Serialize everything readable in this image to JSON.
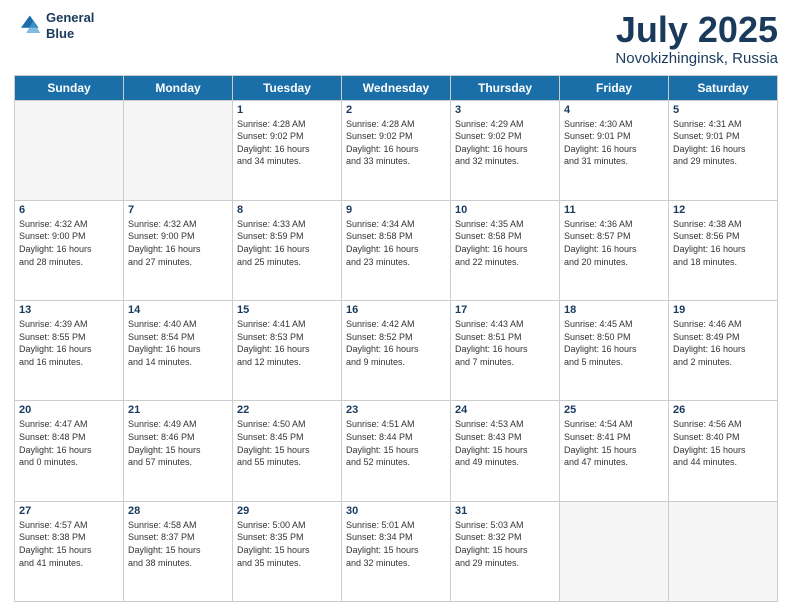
{
  "logo": {
    "line1": "General",
    "line2": "Blue"
  },
  "title": "July 2025",
  "location": "Novokizhinginsk, Russia",
  "header_days": [
    "Sunday",
    "Monday",
    "Tuesday",
    "Wednesday",
    "Thursday",
    "Friday",
    "Saturday"
  ],
  "weeks": [
    [
      {
        "day": "",
        "info": ""
      },
      {
        "day": "",
        "info": ""
      },
      {
        "day": "1",
        "info": "Sunrise: 4:28 AM\nSunset: 9:02 PM\nDaylight: 16 hours\nand 34 minutes."
      },
      {
        "day": "2",
        "info": "Sunrise: 4:28 AM\nSunset: 9:02 PM\nDaylight: 16 hours\nand 33 minutes."
      },
      {
        "day": "3",
        "info": "Sunrise: 4:29 AM\nSunset: 9:02 PM\nDaylight: 16 hours\nand 32 minutes."
      },
      {
        "day": "4",
        "info": "Sunrise: 4:30 AM\nSunset: 9:01 PM\nDaylight: 16 hours\nand 31 minutes."
      },
      {
        "day": "5",
        "info": "Sunrise: 4:31 AM\nSunset: 9:01 PM\nDaylight: 16 hours\nand 29 minutes."
      }
    ],
    [
      {
        "day": "6",
        "info": "Sunrise: 4:32 AM\nSunset: 9:00 PM\nDaylight: 16 hours\nand 28 minutes."
      },
      {
        "day": "7",
        "info": "Sunrise: 4:32 AM\nSunset: 9:00 PM\nDaylight: 16 hours\nand 27 minutes."
      },
      {
        "day": "8",
        "info": "Sunrise: 4:33 AM\nSunset: 8:59 PM\nDaylight: 16 hours\nand 25 minutes."
      },
      {
        "day": "9",
        "info": "Sunrise: 4:34 AM\nSunset: 8:58 PM\nDaylight: 16 hours\nand 23 minutes."
      },
      {
        "day": "10",
        "info": "Sunrise: 4:35 AM\nSunset: 8:58 PM\nDaylight: 16 hours\nand 22 minutes."
      },
      {
        "day": "11",
        "info": "Sunrise: 4:36 AM\nSunset: 8:57 PM\nDaylight: 16 hours\nand 20 minutes."
      },
      {
        "day": "12",
        "info": "Sunrise: 4:38 AM\nSunset: 8:56 PM\nDaylight: 16 hours\nand 18 minutes."
      }
    ],
    [
      {
        "day": "13",
        "info": "Sunrise: 4:39 AM\nSunset: 8:55 PM\nDaylight: 16 hours\nand 16 minutes."
      },
      {
        "day": "14",
        "info": "Sunrise: 4:40 AM\nSunset: 8:54 PM\nDaylight: 16 hours\nand 14 minutes."
      },
      {
        "day": "15",
        "info": "Sunrise: 4:41 AM\nSunset: 8:53 PM\nDaylight: 16 hours\nand 12 minutes."
      },
      {
        "day": "16",
        "info": "Sunrise: 4:42 AM\nSunset: 8:52 PM\nDaylight: 16 hours\nand 9 minutes."
      },
      {
        "day": "17",
        "info": "Sunrise: 4:43 AM\nSunset: 8:51 PM\nDaylight: 16 hours\nand 7 minutes."
      },
      {
        "day": "18",
        "info": "Sunrise: 4:45 AM\nSunset: 8:50 PM\nDaylight: 16 hours\nand 5 minutes."
      },
      {
        "day": "19",
        "info": "Sunrise: 4:46 AM\nSunset: 8:49 PM\nDaylight: 16 hours\nand 2 minutes."
      }
    ],
    [
      {
        "day": "20",
        "info": "Sunrise: 4:47 AM\nSunset: 8:48 PM\nDaylight: 16 hours\nand 0 minutes."
      },
      {
        "day": "21",
        "info": "Sunrise: 4:49 AM\nSunset: 8:46 PM\nDaylight: 15 hours\nand 57 minutes."
      },
      {
        "day": "22",
        "info": "Sunrise: 4:50 AM\nSunset: 8:45 PM\nDaylight: 15 hours\nand 55 minutes."
      },
      {
        "day": "23",
        "info": "Sunrise: 4:51 AM\nSunset: 8:44 PM\nDaylight: 15 hours\nand 52 minutes."
      },
      {
        "day": "24",
        "info": "Sunrise: 4:53 AM\nSunset: 8:43 PM\nDaylight: 15 hours\nand 49 minutes."
      },
      {
        "day": "25",
        "info": "Sunrise: 4:54 AM\nSunset: 8:41 PM\nDaylight: 15 hours\nand 47 minutes."
      },
      {
        "day": "26",
        "info": "Sunrise: 4:56 AM\nSunset: 8:40 PM\nDaylight: 15 hours\nand 44 minutes."
      }
    ],
    [
      {
        "day": "27",
        "info": "Sunrise: 4:57 AM\nSunset: 8:38 PM\nDaylight: 15 hours\nand 41 minutes."
      },
      {
        "day": "28",
        "info": "Sunrise: 4:58 AM\nSunset: 8:37 PM\nDaylight: 15 hours\nand 38 minutes."
      },
      {
        "day": "29",
        "info": "Sunrise: 5:00 AM\nSunset: 8:35 PM\nDaylight: 15 hours\nand 35 minutes."
      },
      {
        "day": "30",
        "info": "Sunrise: 5:01 AM\nSunset: 8:34 PM\nDaylight: 15 hours\nand 32 minutes."
      },
      {
        "day": "31",
        "info": "Sunrise: 5:03 AM\nSunset: 8:32 PM\nDaylight: 15 hours\nand 29 minutes."
      },
      {
        "day": "",
        "info": ""
      },
      {
        "day": "",
        "info": ""
      }
    ]
  ]
}
